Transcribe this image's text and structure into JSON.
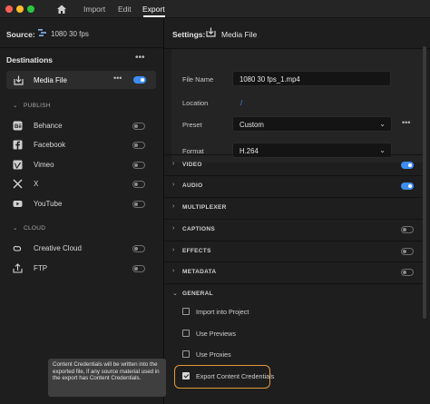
{
  "nav": {
    "tabs": [
      {
        "label": "Import"
      },
      {
        "label": "Edit"
      },
      {
        "label": "Export"
      }
    ],
    "active_tab": "Export"
  },
  "source": {
    "label": "Source:",
    "value": "1080 30 fps"
  },
  "destinations": {
    "title": "Destinations",
    "media_file": {
      "label": "Media File",
      "enabled": true
    },
    "publish_heading": "PUBLISH",
    "publish": [
      {
        "label": "Behance",
        "enabled": false
      },
      {
        "label": "Facebook",
        "enabled": false
      },
      {
        "label": "Vimeo",
        "enabled": false
      },
      {
        "label": "X",
        "enabled": false
      },
      {
        "label": "YouTube",
        "enabled": false
      }
    ],
    "cloud_heading": "CLOUD",
    "cloud": [
      {
        "label": "Creative Cloud",
        "enabled": false
      },
      {
        "label": "FTP",
        "enabled": false
      }
    ]
  },
  "tooltip": {
    "text": "Content Credentials will be written into the exported file, if any source material used in the export has Content Credentials."
  },
  "settings": {
    "title": "Settings:",
    "target": "Media File",
    "file_name_label": "File Name",
    "file_name": "1080 30 fps_1.mp4",
    "location_label": "Location",
    "location": "/",
    "preset_label": "Preset",
    "preset": "Custom",
    "format_label": "Format",
    "format": "H.264"
  },
  "sections": [
    {
      "label": "VIDEO",
      "enabled": true
    },
    {
      "label": "AUDIO",
      "enabled": true
    },
    {
      "label": "MULTIPLEXER"
    },
    {
      "label": "CAPTIONS",
      "enabled": false
    },
    {
      "label": "EFFECTS",
      "enabled": false
    },
    {
      "label": "METADATA",
      "enabled": false
    }
  ],
  "general": {
    "label": "GENERAL",
    "options": [
      {
        "label": "Import into Project",
        "checked": false
      },
      {
        "label": "Use Previews",
        "checked": false
      },
      {
        "label": "Use Proxies",
        "checked": false
      },
      {
        "label": "Export Content Credentials",
        "checked": true
      }
    ]
  },
  "colors": {
    "accent": "#3e8df2",
    "highlight": "#e49a3a"
  }
}
